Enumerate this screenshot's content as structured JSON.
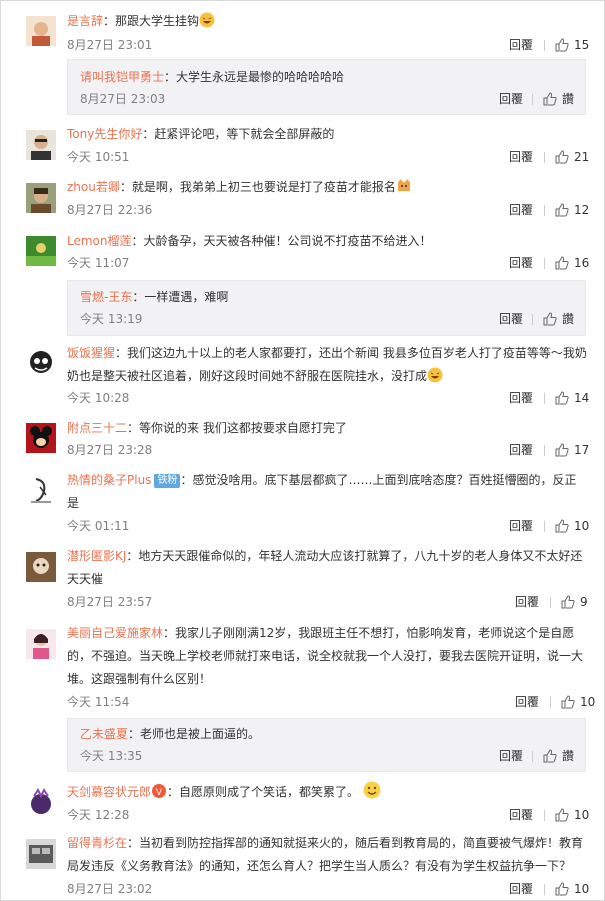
{
  "comments": [
    {
      "user": "是言辞",
      "text": "：那跟大学生挂钩",
      "time": "8月27日 23:01",
      "reply": "回覆",
      "likes": "15"
    },
    {
      "user": "请叫我铠甲勇士",
      "text": "：大学生永远是最惨的哈哈哈哈哈",
      "time": "8月27日 23:03",
      "reply": "回覆",
      "likes": "讚"
    },
    {
      "user": "Tony先生你好",
      "text": "：赶紧评论吧，等下就会全部屏蔽的",
      "time": "今天 10:51",
      "reply": "回覆",
      "likes": "21"
    },
    {
      "user": "zhou若卿",
      "text": "：就是啊，我弟弟上初三也要说是打了疫苗才能报名",
      "time": "8月27日 22:36",
      "reply": "回覆",
      "likes": "12"
    },
    {
      "user": "Lemon榴莲",
      "text": "：大龄备孕，天天被各种催！公司说不打疫苗不给进入！",
      "time": "今天 11:07",
      "reply": "回覆",
      "likes": "16"
    },
    {
      "user": "雪燃-王东",
      "text": "：一样遭遇，难啊",
      "time": "今天 13:19",
      "reply": "回覆",
      "likes": "讚"
    },
    {
      "user": "饭饭猩猩",
      "text": "：我们这边九十以上的老人家都要打，还出个新闻 我县多位百岁老人打了疫苗等等～我奶奶也是整天被社区追着，刚好这段时间她不舒服在医院挂水，没打成",
      "time": "今天 10:28",
      "reply": "回覆",
      "likes": "14"
    },
    {
      "user": "附点三十二",
      "text": "：等你说的来 我们这都按要求自愿打完了",
      "time": "8月27日 23:28",
      "reply": "回覆",
      "likes": "17"
    },
    {
      "user": "热情的桑子Plus",
      "badge": "铁粉",
      "text": "：感觉没啥用。底下基层都疯了……上面到底啥态度？百姓挺懵圈的，反正是",
      "time": "今天 01:11",
      "reply": "回覆",
      "likes": "10"
    },
    {
      "user": "潜形匿影KJ",
      "text": "：地方天天跟催命似的，年轻人流动大应该打就算了，八九十岁的老人身体又不太好还天天催",
      "time": "8月27日 23:57",
      "reply": "回覆",
      "likes": "9"
    },
    {
      "user": "美丽自己爱施家林",
      "text": "：我家儿子刚刚满12岁，我跟班主任不想打，怕影响发育，老师说这个是自愿的，不强迫。当天晚上学校老师就打来电话，说全校就我一个人没打，要我去医院开证明，说一大堆。这跟强制有什么区别！",
      "time": "今天 11:54",
      "reply": "回覆",
      "likes": "10"
    },
    {
      "user": "乙未盛夏",
      "text": "：老师也是被上面逼的。",
      "time": "今天 13:35",
      "reply": "回覆",
      "likes": "讚"
    },
    {
      "user": "天剑慕容状元郎",
      "text": "：自愿原则成了个笑话，都笑累了。",
      "time": "今天 12:28",
      "reply": "回覆",
      "likes": "10"
    },
    {
      "user": "留得青杉在",
      "text": "：当初看到防控指挥部的通知就挺来火的，随后看到教育局的，简直要被气爆炸！教育局发违反《义务教育法》的通知，还怎么育人？把学生当人质么？有没有为学生权益抗争一下？",
      "time": "8月27日 23:02",
      "reply": "回覆",
      "likes": "10"
    }
  ],
  "colors": {
    "username": "#eb7350",
    "meta": "#808080",
    "subbox": "#f2f2f5",
    "badge": "#5fa9e0"
  },
  "icons": {
    "like": "thumbs-up-icon",
    "emoji": "laughing-face-icon"
  }
}
